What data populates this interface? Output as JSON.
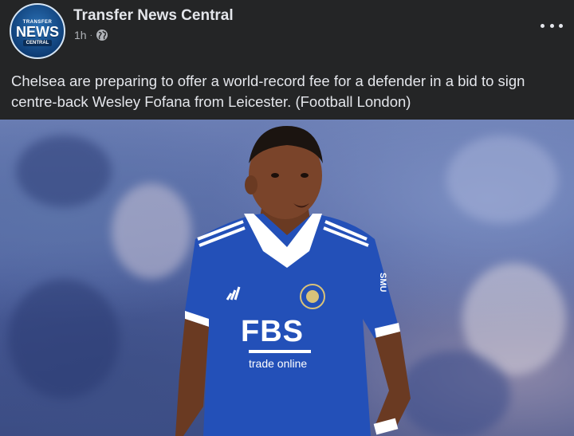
{
  "page": {
    "name": "Transfer News Central",
    "timestamp": "1h",
    "separator": "·",
    "privacy_icon": "globe-icon"
  },
  "avatar": {
    "logo_top": "TRANSFER",
    "logo_main": "NEWS",
    "logo_bottom": "CENTRAL"
  },
  "post": {
    "caption": "Chelsea are preparing to offer a world-record fee for a defender in a bid to sign centre-back Wesley Fofana from Leicester. (Football London)"
  },
  "photo": {
    "sponsor_main": "FBS",
    "sponsor_sub": "trade online",
    "sleeve_text": "SMU"
  },
  "colors": {
    "background": "#242526",
    "text_primary": "#e4e6eb",
    "text_secondary": "#b0b3b8",
    "jersey": "#2350b8"
  },
  "actions": {
    "more_icon": "more-horizontal-icon"
  }
}
